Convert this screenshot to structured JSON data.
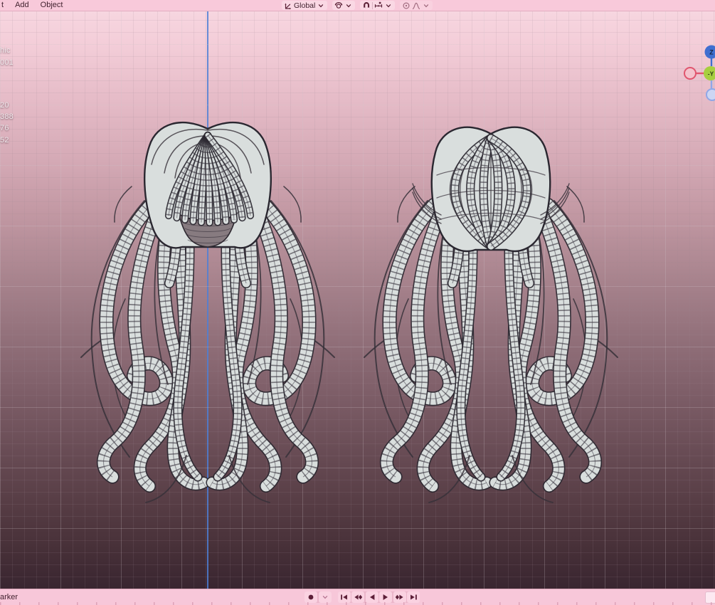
{
  "header": {
    "menus": [
      {
        "label": "t"
      },
      {
        "label": "Add"
      },
      {
        "label": "Object"
      }
    ],
    "orientation": {
      "label": "Global"
    }
  },
  "viewport": {
    "overlay": {
      "line1": "hic",
      "line2": "001"
    },
    "stats": [
      "20",
      "388",
      "76",
      "52"
    ],
    "gizmo": {
      "z_label": "Z",
      "neg_y_label": "-Y"
    },
    "colors": {
      "axis_z": "#4d7fd6",
      "model_fill": "#d9dedd",
      "wire": "#2a2730",
      "bg_top": "#f7d6e0",
      "bg_bottom": "#392530"
    }
  },
  "timeline": {
    "menu_partial": "arker",
    "transport": [
      "record",
      "record-options",
      "jump-to-start",
      "previous-keyframe",
      "play-reverse",
      "play",
      "next-keyframe",
      "jump-to-end"
    ]
  },
  "theme": {
    "header_bg": "#f8c9da",
    "footer_bg": "#f7c7d9",
    "icon_color": "#5c2238",
    "gizmo_z": "#3f6fd0",
    "gizmo_y": "#a7cf3f",
    "gizmo_x": "#e0556e"
  }
}
